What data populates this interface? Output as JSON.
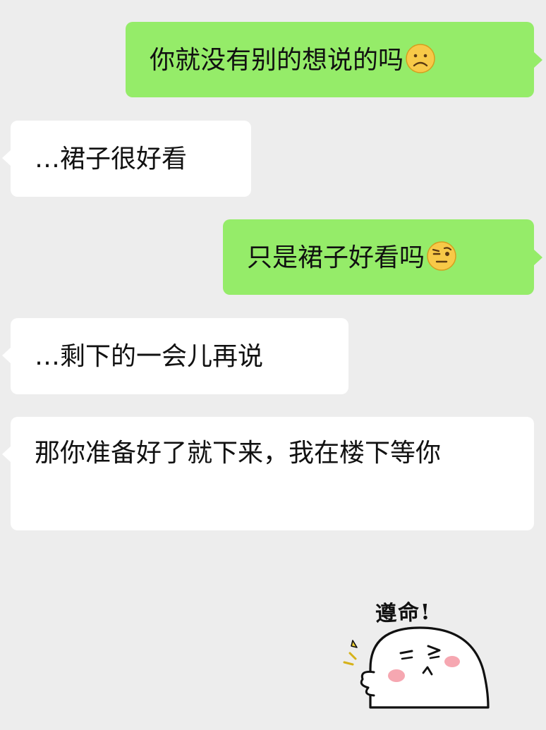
{
  "messages": [
    {
      "side": "sent",
      "text": "你就没有别的想说的吗",
      "emoji": "frowning-face-emoji"
    },
    {
      "side": "received",
      "text": "…裙子很好看"
    },
    {
      "side": "sent",
      "text": "只是裙子好看吗",
      "emoji": "face-with-raised-eyebrow-emoji"
    },
    {
      "side": "received",
      "text": "…剩下的一会儿再说"
    },
    {
      "side": "received",
      "text": "那你准备好了就下来，我在楼下等你"
    }
  ],
  "sticker": {
    "caption": "遵命!",
    "icon": "saluting-bun-sticker"
  },
  "colors": {
    "background": "#ededed",
    "sent_bubble": "#95ec69",
    "received_bubble": "#ffffff",
    "text": "#111111"
  }
}
